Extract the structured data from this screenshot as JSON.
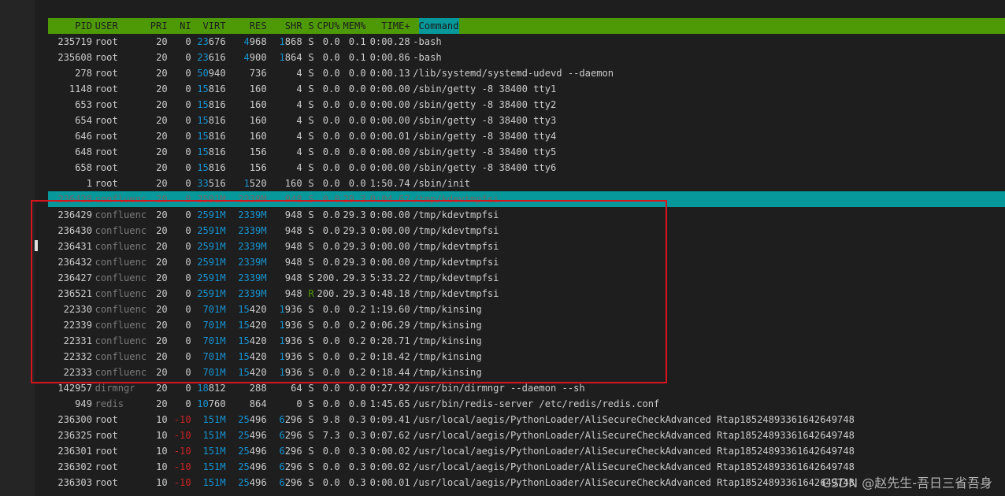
{
  "header": {
    "pid": "PID",
    "user": "USER",
    "pri": "PRI",
    "ni": "NI",
    "virt": "VIRT",
    "res": "RES",
    "shr": "SHR",
    "s": "S",
    "cpu": "CPU%",
    "mem": "MEM%",
    "time": "TIME+",
    "command": "Command"
  },
  "rows": [
    {
      "pid": "235719",
      "user": "root",
      "pri": "20",
      "ni": "0",
      "virt_a": "23",
      "virt_b": "676",
      "res_a": "4",
      "res_b": "968",
      "shr_a": "1",
      "shr_b": "868",
      "s": "S",
      "cpu": "0.0",
      "mem": "0.1",
      "time": "0:00.28",
      "cmd": "-bash"
    },
    {
      "pid": "235608",
      "user": "root",
      "pri": "20",
      "ni": "0",
      "virt_a": "23",
      "virt_b": "616",
      "res_a": "4",
      "res_b": "900",
      "shr_a": "1",
      "shr_b": "864",
      "s": "S",
      "cpu": "0.0",
      "mem": "0.1",
      "time": "0:00.86",
      "cmd": "-bash"
    },
    {
      "pid": "278",
      "user": "root",
      "pri": "20",
      "ni": "0",
      "virt_a": "50",
      "virt_b": "940",
      "res_a": "",
      "res_b": "736",
      "shr_a": "",
      "shr_b": "4",
      "s": "S",
      "cpu": "0.0",
      "mem": "0.0",
      "time": "0:00.13",
      "cmd": "/lib/systemd/systemd-udevd --daemon"
    },
    {
      "pid": "1148",
      "user": "root",
      "pri": "20",
      "ni": "0",
      "virt_a": "15",
      "virt_b": "816",
      "res_a": "",
      "res_b": "160",
      "shr_a": "",
      "shr_b": "4",
      "s": "S",
      "cpu": "0.0",
      "mem": "0.0",
      "time": "0:00.00",
      "cmd": "/sbin/getty -8 38400 tty1"
    },
    {
      "pid": "653",
      "user": "root",
      "pri": "20",
      "ni": "0",
      "virt_a": "15",
      "virt_b": "816",
      "res_a": "",
      "res_b": "160",
      "shr_a": "",
      "shr_b": "4",
      "s": "S",
      "cpu": "0.0",
      "mem": "0.0",
      "time": "0:00.00",
      "cmd": "/sbin/getty -8 38400 tty2"
    },
    {
      "pid": "654",
      "user": "root",
      "pri": "20",
      "ni": "0",
      "virt_a": "15",
      "virt_b": "816",
      "res_a": "",
      "res_b": "160",
      "shr_a": "",
      "shr_b": "4",
      "s": "S",
      "cpu": "0.0",
      "mem": "0.0",
      "time": "0:00.00",
      "cmd": "/sbin/getty -8 38400 tty3"
    },
    {
      "pid": "646",
      "user": "root",
      "pri": "20",
      "ni": "0",
      "virt_a": "15",
      "virt_b": "816",
      "res_a": "",
      "res_b": "160",
      "shr_a": "",
      "shr_b": "4",
      "s": "S",
      "cpu": "0.0",
      "mem": "0.0",
      "time": "0:00.01",
      "cmd": "/sbin/getty -8 38400 tty4"
    },
    {
      "pid": "648",
      "user": "root",
      "pri": "20",
      "ni": "0",
      "virt_a": "15",
      "virt_b": "816",
      "res_a": "",
      "res_b": "156",
      "shr_a": "",
      "shr_b": "4",
      "s": "S",
      "cpu": "0.0",
      "mem": "0.0",
      "time": "0:00.00",
      "cmd": "/sbin/getty -8 38400 tty5"
    },
    {
      "pid": "658",
      "user": "root",
      "pri": "20",
      "ni": "0",
      "virt_a": "15",
      "virt_b": "816",
      "res_a": "",
      "res_b": "156",
      "shr_a": "",
      "shr_b": "4",
      "s": "S",
      "cpu": "0.0",
      "mem": "0.0",
      "time": "0:00.00",
      "cmd": "/sbin/getty -8 38400 tty6"
    },
    {
      "pid": "1",
      "user": "root",
      "pri": "20",
      "ni": "0",
      "virt_a": "33",
      "virt_b": "516",
      "res_a": "1",
      "res_b": "520",
      "shr_a": "",
      "shr_b": "160",
      "s": "S",
      "cpu": "0.0",
      "mem": "0.0",
      "time": "1:50.74",
      "cmd": "/sbin/init"
    },
    {
      "pid": "236428",
      "user": "confluenc",
      "pri": "20",
      "ni": "0",
      "virt_a": "",
      "virt_b": "2591M",
      "res_a": "",
      "res_b": "2339M",
      "shr_a": "",
      "shr_b": "948",
      "s": "S",
      "cpu": "0.0",
      "mem": "29.3",
      "time": "0:04.67",
      "cmd": "/tmp/kdevtmpfsi",
      "selected": true
    },
    {
      "pid": "236429",
      "user": "confluenc",
      "pri": "20",
      "ni": "0",
      "virt_a": "",
      "virt_b": "2591M",
      "res_a": "",
      "res_b": "2339M",
      "shr_a": "",
      "shr_b": "948",
      "s": "S",
      "cpu": "0.0",
      "mem": "29.3",
      "time": "0:00.00",
      "cmd": "/tmp/kdevtmpfsi",
      "hlres": true
    },
    {
      "pid": "236430",
      "user": "confluenc",
      "pri": "20",
      "ni": "0",
      "virt_a": "",
      "virt_b": "2591M",
      "res_a": "",
      "res_b": "2339M",
      "shr_a": "",
      "shr_b": "948",
      "s": "S",
      "cpu": "0.0",
      "mem": "29.3",
      "time": "0:00.00",
      "cmd": "/tmp/kdevtmpfsi",
      "hlres": true
    },
    {
      "pid": "236431",
      "user": "confluenc",
      "pri": "20",
      "ni": "0",
      "virt_a": "",
      "virt_b": "2591M",
      "res_a": "",
      "res_b": "2339M",
      "shr_a": "",
      "shr_b": "948",
      "s": "S",
      "cpu": "0.0",
      "mem": "29.3",
      "time": "0:00.00",
      "cmd": "/tmp/kdevtmpfsi",
      "hlres": true
    },
    {
      "pid": "236432",
      "user": "confluenc",
      "pri": "20",
      "ni": "0",
      "virt_a": "",
      "virt_b": "2591M",
      "res_a": "",
      "res_b": "2339M",
      "shr_a": "",
      "shr_b": "948",
      "s": "S",
      "cpu": "0.0",
      "mem": "29.3",
      "time": "0:00.00",
      "cmd": "/tmp/kdevtmpfsi",
      "hlres": true
    },
    {
      "pid": "236427",
      "user": "confluenc",
      "pri": "20",
      "ni": "0",
      "virt_a": "",
      "virt_b": "2591M",
      "res_a": "",
      "res_b": "2339M",
      "shr_a": "",
      "shr_b": "948",
      "s": "S",
      "cpu": "200.",
      "mem": "29.3",
      "time": "5:33.22",
      "cmd": "/tmp/kdevtmpfsi",
      "hlres": true
    },
    {
      "pid": "236521",
      "user": "confluenc",
      "pri": "20",
      "ni": "0",
      "virt_a": "",
      "virt_b": "2591M",
      "res_a": "",
      "res_b": "2339M",
      "shr_a": "",
      "shr_b": "948",
      "s": "R",
      "cpu": "200.",
      "mem": "29.3",
      "time": "0:48.18",
      "cmd": "/tmp/kdevtmpfsi",
      "hlres": true
    },
    {
      "pid": "22330",
      "user": "confluenc",
      "pri": "20",
      "ni": "0",
      "virt_a": "",
      "virt_b": "701M",
      "res_a": "15",
      "res_b": "420",
      "shr_a": "1",
      "shr_b": "936",
      "s": "S",
      "cpu": "0.0",
      "mem": "0.2",
      "time": "1:19.60",
      "cmd": "/tmp/kinsing",
      "hlvirt": true
    },
    {
      "pid": "22339",
      "user": "confluenc",
      "pri": "20",
      "ni": "0",
      "virt_a": "",
      "virt_b": "701M",
      "res_a": "15",
      "res_b": "420",
      "shr_a": "1",
      "shr_b": "936",
      "s": "S",
      "cpu": "0.0",
      "mem": "0.2",
      "time": "0:06.29",
      "cmd": "/tmp/kinsing",
      "hlvirt": true
    },
    {
      "pid": "22331",
      "user": "confluenc",
      "pri": "20",
      "ni": "0",
      "virt_a": "",
      "virt_b": "701M",
      "res_a": "15",
      "res_b": "420",
      "shr_a": "1",
      "shr_b": "936",
      "s": "S",
      "cpu": "0.0",
      "mem": "0.2",
      "time": "0:20.71",
      "cmd": "/tmp/kinsing",
      "hlvirt": true
    },
    {
      "pid": "22332",
      "user": "confluenc",
      "pri": "20",
      "ni": "0",
      "virt_a": "",
      "virt_b": "701M",
      "res_a": "15",
      "res_b": "420",
      "shr_a": "1",
      "shr_b": "936",
      "s": "S",
      "cpu": "0.0",
      "mem": "0.2",
      "time": "0:18.42",
      "cmd": "/tmp/kinsing",
      "hlvirt": true
    },
    {
      "pid": "22333",
      "user": "confluenc",
      "pri": "20",
      "ni": "0",
      "virt_a": "",
      "virt_b": "701M",
      "res_a": "15",
      "res_b": "420",
      "shr_a": "1",
      "shr_b": "936",
      "s": "S",
      "cpu": "0.0",
      "mem": "0.2",
      "time": "0:18.44",
      "cmd": "/tmp/kinsing",
      "hlvirt": true
    },
    {
      "pid": "142957",
      "user": "dirmngr",
      "pri": "20",
      "ni": "0",
      "virt_a": "18",
      "virt_b": "812",
      "res_a": "",
      "res_b": "288",
      "shr_a": "",
      "shr_b": "64",
      "s": "S",
      "cpu": "0.0",
      "mem": "0.0",
      "time": "0:27.92",
      "cmd": "/usr/bin/dirmngr --daemon --sh"
    },
    {
      "pid": "949",
      "user": "redis",
      "pri": "20",
      "ni": "0",
      "virt_a": "10",
      "virt_b": "760",
      "res_a": "",
      "res_b": "864",
      "shr_a": "",
      "shr_b": "0",
      "s": "S",
      "cpu": "0.0",
      "mem": "0.0",
      "time": "1:45.65",
      "cmd": "/usr/bin/redis-server /etc/redis/redis.conf"
    },
    {
      "pid": "236300",
      "user": "root",
      "pri": "10",
      "ni": "-10",
      "virt_a": "",
      "virt_b": "151M",
      "res_a": "25",
      "res_b": "496",
      "shr_a": "6",
      "shr_b": "296",
      "s": "S",
      "cpu": "9.8",
      "mem": "0.3",
      "time": "0:09.41",
      "cmd": "/usr/local/aegis/PythonLoader/AliSecureCheckAdvanced Rtap18524893361642649748",
      "hlvirt": true
    },
    {
      "pid": "236325",
      "user": "root",
      "pri": "10",
      "ni": "-10",
      "virt_a": "",
      "virt_b": "151M",
      "res_a": "25",
      "res_b": "496",
      "shr_a": "6",
      "shr_b": "296",
      "s": "S",
      "cpu": "7.3",
      "mem": "0.3",
      "time": "0:07.62",
      "cmd": "/usr/local/aegis/PythonLoader/AliSecureCheckAdvanced Rtap18524893361642649748",
      "hlvirt": true
    },
    {
      "pid": "236301",
      "user": "root",
      "pri": "10",
      "ni": "-10",
      "virt_a": "",
      "virt_b": "151M",
      "res_a": "25",
      "res_b": "496",
      "shr_a": "6",
      "shr_b": "296",
      "s": "S",
      "cpu": "0.0",
      "mem": "0.3",
      "time": "0:00.02",
      "cmd": "/usr/local/aegis/PythonLoader/AliSecureCheckAdvanced Rtap18524893361642649748",
      "hlvirt": true
    },
    {
      "pid": "236302",
      "user": "root",
      "pri": "10",
      "ni": "-10",
      "virt_a": "",
      "virt_b": "151M",
      "res_a": "25",
      "res_b": "496",
      "shr_a": "6",
      "shr_b": "296",
      "s": "S",
      "cpu": "0.0",
      "mem": "0.3",
      "time": "0:00.02",
      "cmd": "/usr/local/aegis/PythonLoader/AliSecureCheckAdvanced Rtap18524893361642649748",
      "hlvirt": true
    },
    {
      "pid": "236303",
      "user": "root",
      "pri": "10",
      "ni": "-10",
      "virt_a": "",
      "virt_b": "151M",
      "res_a": "25",
      "res_b": "496",
      "shr_a": "6",
      "shr_b": "296",
      "s": "S",
      "cpu": "0.0",
      "mem": "0.3",
      "time": "0:00.01",
      "cmd": "/usr/local/aegis/PythonLoader/AliSecureCheckAdvanced Rtap18524893361642649748",
      "hlvirt": true
    }
  ],
  "watermark": "CSDN @赵先生-吾日三省吾身",
  "colors": {
    "background": "#1e1e1e",
    "header_bar": "#4e9a06",
    "selected_row": "#06989a",
    "highlight_number": "#1793d1",
    "negative_nice": "#cc2222",
    "annotation_box": "#d9141d"
  }
}
